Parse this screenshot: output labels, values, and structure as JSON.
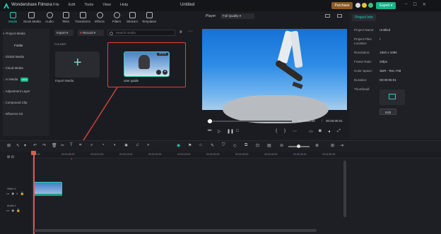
{
  "app": {
    "title": "Wondershare Filmora",
    "document_title": "Untitled"
  },
  "menu": [
    "File",
    "Edit",
    "Tools",
    "View",
    "Help"
  ],
  "header": {
    "purchase_label": "Purchase",
    "export_label": "Export",
    "win_min": "–",
    "win_max": "☐",
    "win_close": "✕"
  },
  "toolbar": {
    "items": [
      {
        "label": "Media",
        "icon": "media-icon"
      },
      {
        "label": "Stock Media",
        "icon": "stock-media-icon"
      },
      {
        "label": "Audio",
        "icon": "audio-icon"
      },
      {
        "label": "Titles",
        "icon": "titles-icon"
      },
      {
        "label": "Transitions",
        "icon": "transitions-icon"
      },
      {
        "label": "Effects",
        "icon": "effects-icon"
      },
      {
        "label": "Filters",
        "icon": "filters-icon"
      },
      {
        "label": "Stickers",
        "icon": "stickers-icon"
      },
      {
        "label": "Templates",
        "icon": "templates-icon"
      }
    ]
  },
  "sidebar": {
    "items": [
      {
        "label": "Project Media"
      },
      {
        "label": "Folder"
      },
      {
        "label": "Global Media"
      },
      {
        "label": "Cloud Media"
      },
      {
        "label": "AI Media",
        "badge": "NEW"
      },
      {
        "label": "Adjustment Layer"
      },
      {
        "label": "Compound Clip"
      },
      {
        "label": "Influence Kit"
      }
    ]
  },
  "media": {
    "import_label": "Import",
    "record_label": "Record",
    "search_placeholder": "Search media",
    "folder_label": "FOLDER",
    "import_media_label": "Import Media",
    "clip_name": "user guide",
    "clip_badge": "00:00:05"
  },
  "player": {
    "label": "Player",
    "quality": "Full Quality",
    "current_time": "00:00:00:05",
    "separator": "/",
    "total_time": "00:00:05:01"
  },
  "project_info": {
    "tab": "Project Info",
    "rows": [
      {
        "key": "Project Name:",
        "value": "Untitled"
      },
      {
        "key": "Project Files Location:",
        "value": "/"
      },
      {
        "key": "Resolution:",
        "value": "1920 x 1080"
      },
      {
        "key": "Frame Rate:",
        "value": "25fps"
      },
      {
        "key": "Color Space:",
        "value": "SDR - Rec.709"
      },
      {
        "key": "Duration:",
        "value": "00:00:05:01"
      },
      {
        "key": "Thumbnail:",
        "value": ""
      }
    ],
    "edit_label": "Edit"
  },
  "timeline": {
    "ruler": [
      "00:00",
      "00:00:05:00",
      "00:00:10:00",
      "00:00:15:00",
      "00:00:20:00",
      "00:00:25:00",
      "00:00:30:00",
      "00:00:35:00",
      "00:00:40:00",
      "00:00:45:00",
      "00:00:50:00"
    ],
    "tracks": [
      {
        "name": "Video 1"
      },
      {
        "name": "Audio 1"
      }
    ]
  },
  "colors": {
    "accent": "#20d3b8",
    "purchase": "#8b5a22",
    "export": "#15b58a",
    "highlight": "#e0433d"
  }
}
